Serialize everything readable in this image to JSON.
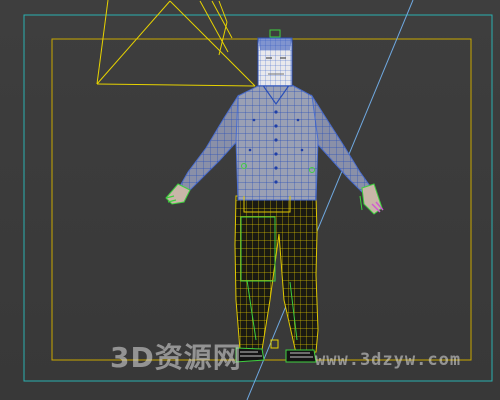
{
  "viewport": {
    "background": "#3a3a3a",
    "safe_frame_color": "#d4b000",
    "outer_frame_color": "#2ab0b0",
    "camera_color": "#e6d200",
    "guide_line_color": "#7ab6e6",
    "wireframe_body_color": "#c9b200",
    "wireframe_shirt_color": "#5a8fd8",
    "helper_green": "#3fd03f",
    "helper_magenta": "#d05ad0"
  },
  "watermark": {
    "text": "3D资源网",
    "url": "www.3dzyw.com"
  }
}
